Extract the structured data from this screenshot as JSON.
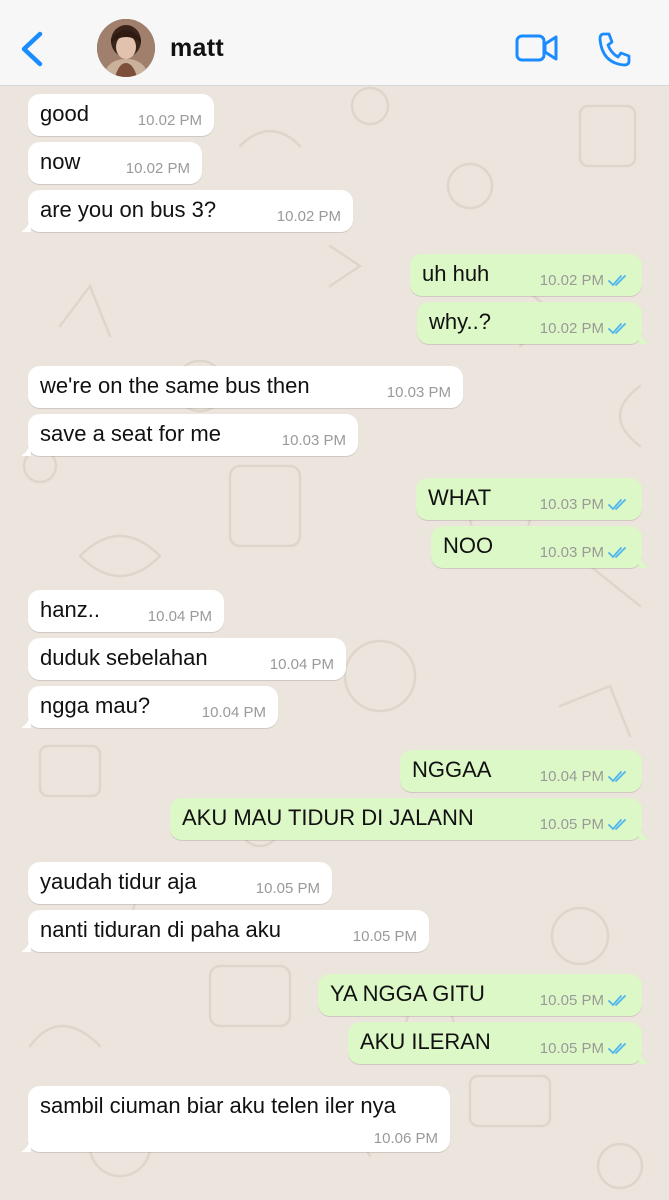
{
  "header": {
    "contact_name": "matt",
    "back_icon": "chevron-left-icon",
    "video_icon": "video-camera-icon",
    "call_icon": "phone-icon",
    "accent_color": "#1a8cff"
  },
  "messages": [
    {
      "dir": "in",
      "text": "good",
      "time": "10.02 PM"
    },
    {
      "dir": "in",
      "text": "now",
      "time": "10.02 PM"
    },
    {
      "dir": "in",
      "text": "are you on bus 3?",
      "time": "10.02 PM"
    },
    {
      "dir": "out",
      "text": "uh huh",
      "time": "10.02 PM",
      "status": "read"
    },
    {
      "dir": "out",
      "text": "why..?",
      "time": "10.02 PM",
      "status": "read"
    },
    {
      "dir": "in",
      "text": "we're on the same bus then",
      "time": "10.03 PM"
    },
    {
      "dir": "in",
      "text": "save a seat for me",
      "time": "10.03 PM"
    },
    {
      "dir": "out",
      "text": "WHAT",
      "time": "10.03 PM",
      "status": "read"
    },
    {
      "dir": "out",
      "text": "NOO",
      "time": "10.03 PM",
      "status": "read"
    },
    {
      "dir": "in",
      "text": "hanz..",
      "time": "10.04 PM"
    },
    {
      "dir": "in",
      "text": "duduk sebelahan",
      "time": "10.04 PM"
    },
    {
      "dir": "in",
      "text": "ngga mau?",
      "time": "10.04 PM"
    },
    {
      "dir": "out",
      "text": "NGGAA",
      "time": "10.04 PM",
      "status": "read"
    },
    {
      "dir": "out",
      "text": "AKU MAU TIDUR DI JALANN",
      "time": "10.05 PM",
      "status": "read"
    },
    {
      "dir": "in",
      "text": "yaudah tidur aja",
      "time": "10.05 PM"
    },
    {
      "dir": "in",
      "text": "nanti tiduran di paha aku",
      "time": "10.05 PM"
    },
    {
      "dir": "out",
      "text": "YA NGGA GITU",
      "time": "10.05 PM",
      "status": "read"
    },
    {
      "dir": "out",
      "text": "AKU ILERAN",
      "time": "10.05 PM",
      "status": "read"
    },
    {
      "dir": "in",
      "text": "sambil ciuman biar aku telen iler nya",
      "time": "10.06 PM"
    }
  ],
  "colors": {
    "incoming_bubble": "#ffffff",
    "outgoing_bubble": "#dcf8c6",
    "read_ticks": "#4fb6ec",
    "chat_background": "#ece5dd"
  }
}
